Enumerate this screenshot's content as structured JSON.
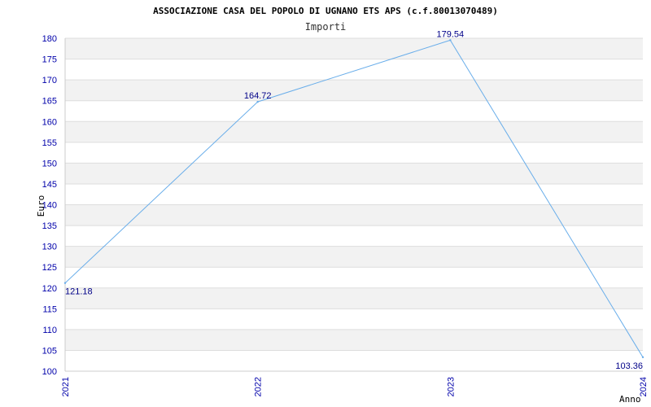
{
  "chart_data": {
    "type": "line",
    "title": "ASSOCIAZIONE CASA DEL POPOLO DI UGNANO ETS APS (c.f.80013070489)",
    "subtitle": "Importi",
    "xlabel": "Anno",
    "ylabel": "Euro",
    "ylim": [
      100,
      180
    ],
    "ytick_step": 5,
    "grid": true,
    "categories": [
      "2021",
      "2022",
      "2023",
      "2024"
    ],
    "series": [
      {
        "values": [
          121.18,
          164.72,
          179.54,
          103.36
        ],
        "labels": [
          "121.18",
          "164.72",
          "179.54",
          "103.36"
        ]
      }
    ],
    "colors": {
      "line": "#6aaeea",
      "band": "#f2f2f2",
      "tick_text": "#0000aa",
      "label_text": "#000088"
    }
  }
}
